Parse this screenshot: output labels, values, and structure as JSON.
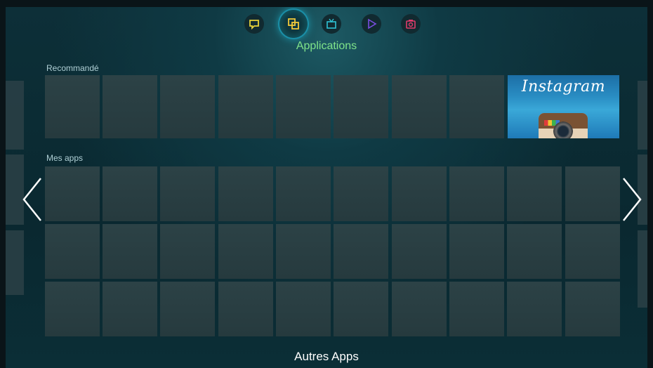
{
  "nav": {
    "items": [
      {
        "name": "social-icon",
        "color": "#e8d23a",
        "active": false
      },
      {
        "name": "apps-icon",
        "color": "#f0c93a",
        "active": true
      },
      {
        "name": "tv-icon",
        "color": "#2ec4d6",
        "active": false
      },
      {
        "name": "play-icon",
        "color": "#7a4de0",
        "active": false
      },
      {
        "name": "camera-icon",
        "color": "#e03b6a",
        "active": false
      }
    ],
    "section_title": "Applications"
  },
  "recommended": {
    "label": "Recommandé",
    "featured_label": "Instagram"
  },
  "my_apps": {
    "label": "Mes apps"
  },
  "footer": {
    "label": "Autres Apps"
  }
}
